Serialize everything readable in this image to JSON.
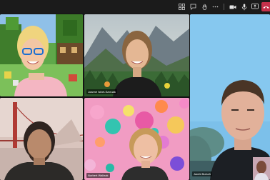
{
  "participants": [
    {
      "name": ""
    },
    {
      "name": "Joanne Isfort-Szcruak"
    },
    {
      "name": "Jacek Bursch"
    },
    {
      "name": ""
    },
    {
      "name": "Norbert Waltzak"
    }
  ],
  "toolbar": {
    "icons": [
      "apps-icon",
      "chat-icon",
      "raise-hand-icon",
      "more-icon",
      "camera-icon",
      "mic-icon",
      "share-screen-icon",
      "leave-icon"
    ]
  },
  "colors": {
    "leave": "#c4314b",
    "toolbar_bg": "#1b1b1b"
  }
}
